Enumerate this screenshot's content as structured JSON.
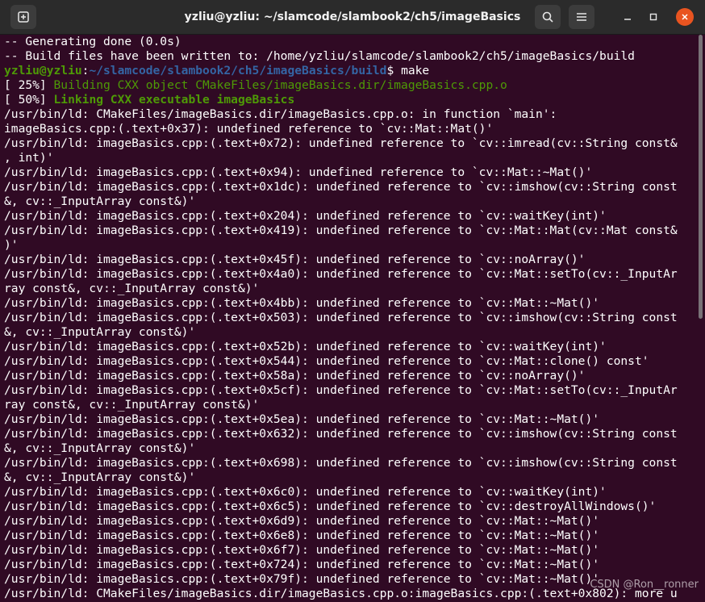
{
  "window": {
    "title": "yzliu@yzliu: ~/slamcode/slambook2/ch5/imageBasics",
    "buttons": {
      "new_tab": "+",
      "search": "search",
      "menu": "menu",
      "minimize": "–",
      "maximize": "□",
      "close": "✕"
    }
  },
  "colors": {
    "background": "#300a24",
    "titlebar": "#2b2b2b",
    "prompt_user": "#4e9a06",
    "prompt_path": "#3465a4",
    "close_button": "#e95420"
  },
  "terminal": {
    "pre_lines": [
      "-- Generating done (0.0s)",
      "-- Build files have been written to: /home/yzliu/slamcode/slambook2/ch5/imageBasics/build"
    ],
    "prompt": {
      "user": "yzliu@yzliu",
      "sep": ":",
      "path": "~/slamcode/slambook2/ch5/imageBasics/build",
      "symbol": "$ ",
      "command": "make"
    },
    "progress_lines": [
      {
        "pct": "[ 25%] ",
        "text": "Building CXX object CMakeFiles/imageBasics.dir/imageBasics.cpp.o",
        "bold": false
      },
      {
        "pct": "[ 50%] ",
        "text": "Linking CXX executable imageBasics",
        "bold": true
      }
    ],
    "output_lines": [
      "/usr/bin/ld: CMakeFiles/imageBasics.dir/imageBasics.cpp.o: in function `main':",
      "imageBasics.cpp:(.text+0x37): undefined reference to `cv::Mat::Mat()'",
      "/usr/bin/ld: imageBasics.cpp:(.text+0x72): undefined reference to `cv::imread(cv::String const&",
      ", int)'",
      "/usr/bin/ld: imageBasics.cpp:(.text+0x94): undefined reference to `cv::Mat::~Mat()'",
      "/usr/bin/ld: imageBasics.cpp:(.text+0x1dc): undefined reference to `cv::imshow(cv::String const",
      "&, cv::_InputArray const&)'",
      "/usr/bin/ld: imageBasics.cpp:(.text+0x204): undefined reference to `cv::waitKey(int)'",
      "/usr/bin/ld: imageBasics.cpp:(.text+0x419): undefined reference to `cv::Mat::Mat(cv::Mat const&",
      ")'",
      "/usr/bin/ld: imageBasics.cpp:(.text+0x45f): undefined reference to `cv::noArray()'",
      "/usr/bin/ld: imageBasics.cpp:(.text+0x4a0): undefined reference to `cv::Mat::setTo(cv::_InputAr",
      "ray const&, cv::_InputArray const&)'",
      "/usr/bin/ld: imageBasics.cpp:(.text+0x4bb): undefined reference to `cv::Mat::~Mat()'",
      "/usr/bin/ld: imageBasics.cpp:(.text+0x503): undefined reference to `cv::imshow(cv::String const",
      "&, cv::_InputArray const&)'",
      "/usr/bin/ld: imageBasics.cpp:(.text+0x52b): undefined reference to `cv::waitKey(int)'",
      "/usr/bin/ld: imageBasics.cpp:(.text+0x544): undefined reference to `cv::Mat::clone() const'",
      "/usr/bin/ld: imageBasics.cpp:(.text+0x58a): undefined reference to `cv::noArray()'",
      "/usr/bin/ld: imageBasics.cpp:(.text+0x5cf): undefined reference to `cv::Mat::setTo(cv::_InputAr",
      "ray const&, cv::_InputArray const&)'",
      "/usr/bin/ld: imageBasics.cpp:(.text+0x5ea): undefined reference to `cv::Mat::~Mat()'",
      "/usr/bin/ld: imageBasics.cpp:(.text+0x632): undefined reference to `cv::imshow(cv::String const",
      "&, cv::_InputArray const&)'",
      "/usr/bin/ld: imageBasics.cpp:(.text+0x698): undefined reference to `cv::imshow(cv::String const",
      "&, cv::_InputArray const&)'",
      "/usr/bin/ld: imageBasics.cpp:(.text+0x6c0): undefined reference to `cv::waitKey(int)'",
      "/usr/bin/ld: imageBasics.cpp:(.text+0x6c5): undefined reference to `cv::destroyAllWindows()'",
      "/usr/bin/ld: imageBasics.cpp:(.text+0x6d9): undefined reference to `cv::Mat::~Mat()'",
      "/usr/bin/ld: imageBasics.cpp:(.text+0x6e8): undefined reference to `cv::Mat::~Mat()'",
      "/usr/bin/ld: imageBasics.cpp:(.text+0x6f7): undefined reference to `cv::Mat::~Mat()'",
      "/usr/bin/ld: imageBasics.cpp:(.text+0x724): undefined reference to `cv::Mat::~Mat()'",
      "/usr/bin/ld: imageBasics.cpp:(.text+0x79f): undefined reference to `cv::Mat::~Mat()'",
      "/usr/bin/ld: CMakeFiles/imageBasics.dir/imageBasics.cpp.o:imageBasics.cpp:(.text+0x802): more u"
    ]
  },
  "watermark": "CSDN @Ron__ronner"
}
